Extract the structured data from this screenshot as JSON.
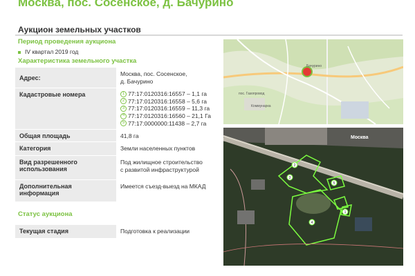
{
  "header": {
    "title": "Москва, пос. Сосенское, д. Бачурино"
  },
  "section": {
    "title": "Аукцион земельных участков"
  },
  "period": {
    "heading": "Период проведения аукциона",
    "item": "IV квартал 2019 год"
  },
  "characteristics": {
    "heading": "Характеристика земельного участка",
    "address_label": "Адрес:",
    "address_line1": "Москва, пос. Сосенское,",
    "address_line2": "д. Бачурино",
    "cadastral_label": "Кадастровые номера",
    "cadastral": [
      {
        "n": "1",
        "text": "77:17:0120316:16557 – 1,1 га"
      },
      {
        "n": "2",
        "text": "77:17:0120316:16558 – 5,6 га"
      },
      {
        "n": "3",
        "text": "77:17:0120316:16559 – 11,3 га"
      },
      {
        "n": "4",
        "text": "77:17:0120316:16560 – 21,1 Га"
      },
      {
        "n": "5",
        "text": "77:17:0000000:11438 – 2,7 га"
      }
    ],
    "area_label": "Общая площадь",
    "area_value": "41,8 га",
    "category_label": "Категория",
    "category_value": "Земли населенных пунктов",
    "use_label_1": "Вид разрешенного",
    "use_label_2": "использования",
    "use_value_1": "Под жилищное строительство",
    "use_value_2": "с развитой инфраструктурой",
    "extra_label_1": "Дополнительная",
    "extra_label_2": "информация",
    "extra_value": "Имеется съезд-выезд на МКАД"
  },
  "status": {
    "heading": "Статус аукциона",
    "stage_label": "Текущая стадия",
    "stage_value": "Подготовка к реализации"
  },
  "map_top": {
    "label_gazoprovod": "пос. Газопровод",
    "label_kommunarka": "Коммунарка",
    "label_bachurino": "Бачурино",
    "marker_color": "#e53935"
  },
  "map_sat": {
    "label_moskva": "Москва",
    "plot_numbers": [
      "1",
      "2",
      "3",
      "4",
      "5"
    ],
    "outline_color": "#7cfc40"
  },
  "colors": {
    "accent": "#7cc242",
    "label_bg": "#ebebeb"
  }
}
